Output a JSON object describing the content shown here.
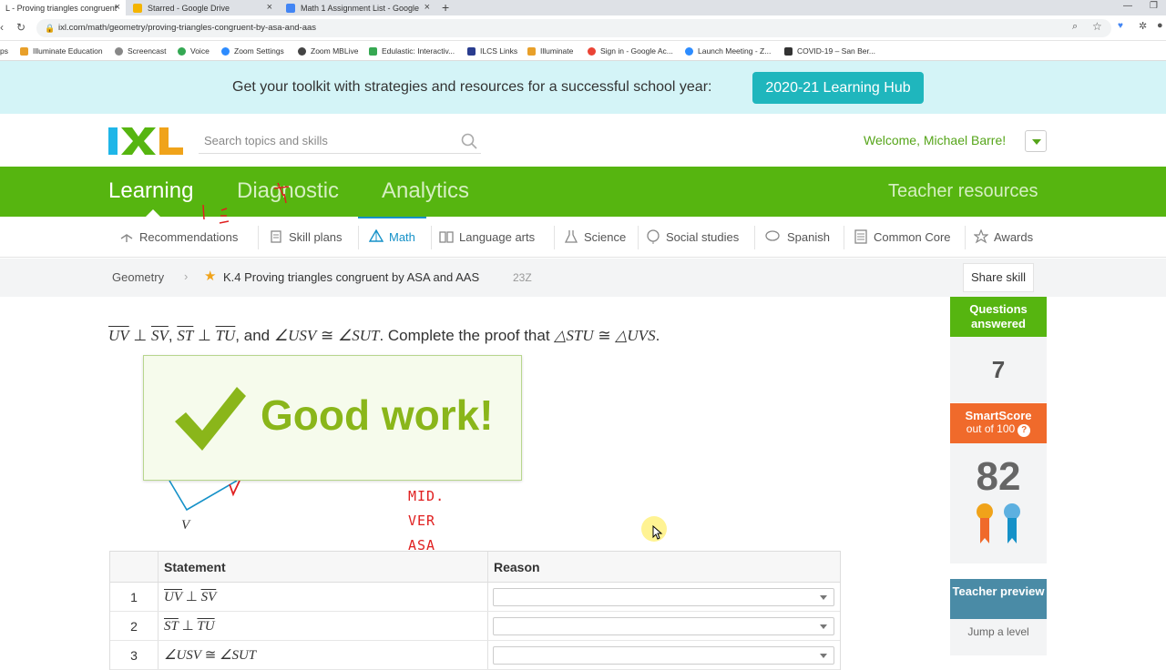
{
  "browser": {
    "tabs": [
      {
        "title": "L - Proving triangles congruent",
        "active": true
      },
      {
        "title": "Starred - Google Drive",
        "active": false
      },
      {
        "title": "Math 1 Assignment List - Google",
        "active": false
      }
    ],
    "new_tab": "+",
    "close": "×",
    "url": "ixl.com/math/geometry/proving-triangles-congruent-by-asa-and-aas",
    "bookmarks": [
      "ps",
      "Illuminate Education",
      "Screencast",
      "Voice",
      "Zoom Settings",
      "Zoom MBLive",
      "Edulastic: Interactiv...",
      "ILCS Links",
      "Illuminate",
      "Sign in - Google Ac...",
      "Launch Meeting - Z...",
      "COVID-19 – San Ber..."
    ]
  },
  "banner": {
    "text": "Get your toolkit with strategies and resources for a successful school year:",
    "button": "2020-21 Learning Hub"
  },
  "header": {
    "search_placeholder": "Search topics and skills",
    "welcome": "Welcome, Michael Barre!"
  },
  "main_nav": {
    "items": [
      "Learning",
      "Diagnostic",
      "Analytics"
    ],
    "teacher": "Teacher resources"
  },
  "sub_nav": {
    "items": [
      "Recommendations",
      "Skill plans",
      "Math",
      "Language arts",
      "Science",
      "Social studies",
      "Spanish",
      "Common Core",
      "Awards"
    ]
  },
  "breadcrumb": {
    "subject": "Geometry",
    "skill": "K.4 Proving triangles congruent by ASA and AAS",
    "code": "23Z",
    "share": "Share skill"
  },
  "question": {
    "seg1": "UV",
    "seg2": "SV",
    "seg3": "ST",
    "seg4": "TU",
    "perp": "⊥",
    "comma": ",",
    "and_text": ", and",
    "angle1": "∠USV",
    "cong": "≅",
    "angle2": "∠SUT",
    "complete": ". Complete the proof that",
    "tri1": "△STU",
    "tri2": "△UVS",
    "end": "."
  },
  "feedback": {
    "text": "Good work!"
  },
  "diagram": {
    "vertex_label": "V",
    "annotations": [
      "MID.",
      "VER",
      "ASA"
    ]
  },
  "proof": {
    "headers": {
      "statement": "Statement",
      "reason": "Reason"
    },
    "rows": [
      {
        "num": "1",
        "a": "UV",
        "op": "⊥",
        "b": "SV"
      },
      {
        "num": "2",
        "a": "ST",
        "op": "⊥",
        "b": "TU"
      },
      {
        "num": "3",
        "a": "∠USV",
        "op": "≅",
        "b": "∠SUT"
      }
    ]
  },
  "sidebar": {
    "questions_label": "Questions answered",
    "questions_value": "7",
    "smartscore_label": "SmartScore",
    "smartscore_sub": "out of 100",
    "smartscore_help": "?",
    "smartscore_value": "82",
    "teacher_preview": "Teacher preview",
    "jump": "Jump a level"
  },
  "colors": {
    "green": "#56b510",
    "orange": "#f06a2b",
    "blue": "#1591c8",
    "teal": "#1fb6bd"
  }
}
